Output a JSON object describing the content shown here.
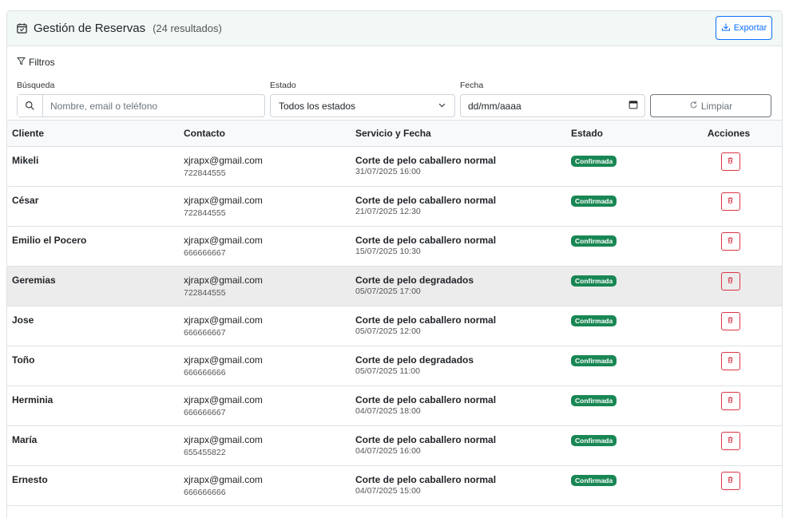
{
  "header": {
    "title": "Gestión de Reservas",
    "count": "(24 resultados)",
    "export_label": "Exportar"
  },
  "filters": {
    "title": "Filtros",
    "search_label": "Búsqueda",
    "search_placeholder": "Nombre, email o teléfono",
    "estado_label": "Estado",
    "estado_value": "Todos los estados",
    "fecha_label": "Fecha",
    "fecha_value": "dd/mm/aaaa",
    "limpiar_label": "Limpiar"
  },
  "table": {
    "columns": [
      "Cliente",
      "Contacto",
      "Servicio y Fecha",
      "Estado",
      "Acciones"
    ],
    "rows": [
      {
        "cliente": "Mikeli",
        "email": "xjrapx@gmail.com",
        "phone": "722844555",
        "servicio": "Corte de pelo caballero normal",
        "fecha": "31/07/2025 16:00",
        "estado": "Confirmada"
      },
      {
        "cliente": "César",
        "email": "xjrapx@gmail.com",
        "phone": "722844555",
        "servicio": "Corte de pelo caballero normal",
        "fecha": "21/07/2025 12:30",
        "estado": "Confirmada"
      },
      {
        "cliente": "Emilio el Pocero",
        "email": "xjrapx@gmail.com",
        "phone": "666666667",
        "servicio": "Corte de pelo caballero normal",
        "fecha": "15/07/2025 10:30",
        "estado": "Confirmada"
      },
      {
        "cliente": "Geremias",
        "email": "xjrapx@gmail.com",
        "phone": "722844555",
        "servicio": "Corte de pelo degradados",
        "fecha": "05/07/2025 17:00",
        "estado": "Confirmada"
      },
      {
        "cliente": "Jose",
        "email": "xjrapx@gmail.com",
        "phone": "666666667",
        "servicio": "Corte de pelo caballero normal",
        "fecha": "05/07/2025 12:00",
        "estado": "Confirmada"
      },
      {
        "cliente": "Toño",
        "email": "xjrapx@gmail.com",
        "phone": "666666666",
        "servicio": "Corte de pelo degradados",
        "fecha": "05/07/2025 11:00",
        "estado": "Confirmada"
      },
      {
        "cliente": "Herminia",
        "email": "xjrapx@gmail.com",
        "phone": "666666667",
        "servicio": "Corte de pelo caballero normal",
        "fecha": "04/07/2025 18:00",
        "estado": "Confirmada"
      },
      {
        "cliente": "María",
        "email": "xjrapx@gmail.com",
        "phone": "655455822",
        "servicio": "Corte de pelo caballero normal",
        "fecha": "04/07/2025 16:00",
        "estado": "Confirmada"
      },
      {
        "cliente": "Ernesto",
        "email": "xjrapx@gmail.com",
        "phone": "666666666",
        "servicio": "Corte de pelo caballero normal",
        "fecha": "04/07/2025 15:00",
        "estado": "Confirmada"
      }
    ]
  },
  "colors": {
    "accent": "#0d6efd",
    "success": "#198754",
    "danger": "#dc3545",
    "header_bg": "#f1f8f6"
  },
  "icons": [
    "calendar-check-icon",
    "download-icon",
    "filter-icon",
    "search-icon",
    "chevron-down-icon",
    "calendar-icon",
    "refresh-icon",
    "trash-icon"
  ]
}
